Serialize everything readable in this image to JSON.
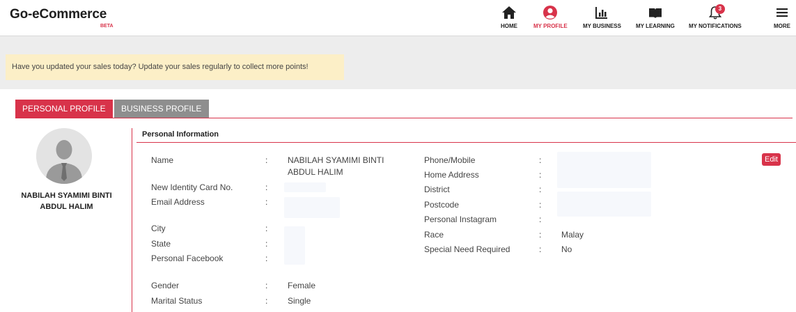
{
  "app": {
    "name": "Go-eCommerce",
    "tag": "BETA"
  },
  "nav": {
    "home": "HOME",
    "profile": "MY PROFILE",
    "business": "MY BUSINESS",
    "learning": "MY LEARNING",
    "notifications": "MY NOTIFICATIONS",
    "notifications_count": "3",
    "more": "MORE"
  },
  "banner": "Have you updated your sales today? Update your sales regularly to collect more points!",
  "tabs": {
    "personal": "PERSONAL PROFILE",
    "business": "BUSINESS PROFILE"
  },
  "profile": {
    "name_line1": "NABILAH SYAMIMI BINTI",
    "name_line2": "ABDUL HALIM"
  },
  "section": {
    "title": "Personal Information",
    "edit": "Edit"
  },
  "fields_left": {
    "name_label": "Name",
    "name_value_1": "NABILAH SYAMIMI BINTI",
    "name_value_2": "ABDUL HALIM",
    "ic_label": "New Identity Card No.",
    "email_label": "Email Address",
    "city_label": "City",
    "state_label": "State",
    "facebook_label": "Personal Facebook",
    "gender_label": "Gender",
    "gender_value": "Female",
    "marital_label": "Marital Status",
    "marital_value": "Single"
  },
  "fields_right": {
    "phone_label": "Phone/Mobile",
    "address_label": "Home Address",
    "district_label": "District",
    "postcode_label": "Postcode",
    "instagram_label": "Personal Instagram",
    "race_label": "Race",
    "race_value": "Malay",
    "special_label": "Special Need Required",
    "special_value": "No"
  },
  "colon": ":",
  "theme": {
    "accent": "#d8334a",
    "tab_inactive": "#8e8e8e",
    "banner_bg": "#fcefc7",
    "band_bg": "#ededed"
  }
}
